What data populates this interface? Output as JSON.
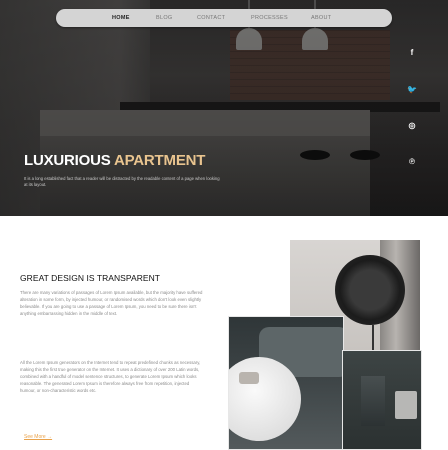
{
  "nav": {
    "items": [
      {
        "label": "HOME",
        "active": true
      },
      {
        "label": "BLOG",
        "active": false
      },
      {
        "label": "CONTACT",
        "active": false
      },
      {
        "label": "PROCESSES",
        "active": false
      },
      {
        "label": "ABOUT",
        "active": false
      }
    ]
  },
  "social": {
    "icons": [
      {
        "name": "facebook-icon",
        "glyph": "f"
      },
      {
        "name": "twitter-icon",
        "glyph": "🐦"
      },
      {
        "name": "instagram-icon",
        "glyph": "◎"
      },
      {
        "name": "pinterest-icon",
        "glyph": "℗"
      }
    ]
  },
  "hero": {
    "title_main": "LUXURIOUS",
    "title_accent": "APARTMENT",
    "subtitle": "It is a long established fact that a reader will be distracted by the readable content of a page when looking at its layout."
  },
  "content": {
    "title": "GREAT DESIGN IS TRANSPARENT",
    "paragraph1": "There are many variations of passages of Lorem Ipsum available, but the majority have suffered alteration in some form, by injected humour, or randomised words which don't look even slightly believable. If you are going to use a passage of Lorem Ipsum, you need to be sure there isn't anything embarrassing hidden in the middle of text.",
    "paragraph2": "All the Lorem Ipsum generators on the Internet tend to repeat predefined chunks as necessary, making this the first true generator on the Internet. It uses a dictionary of over 200 Latin words, combined with a handful of model sentence structures, to generate Lorem Ipsum which looks reasonable. The generated Lorem Ipsum is therefore always free from repetition, injected humour, or non-characteristic words etc.",
    "more_label": "See More →"
  },
  "colors": {
    "accent": "#e9c48f",
    "link": "#e9a24a"
  }
}
